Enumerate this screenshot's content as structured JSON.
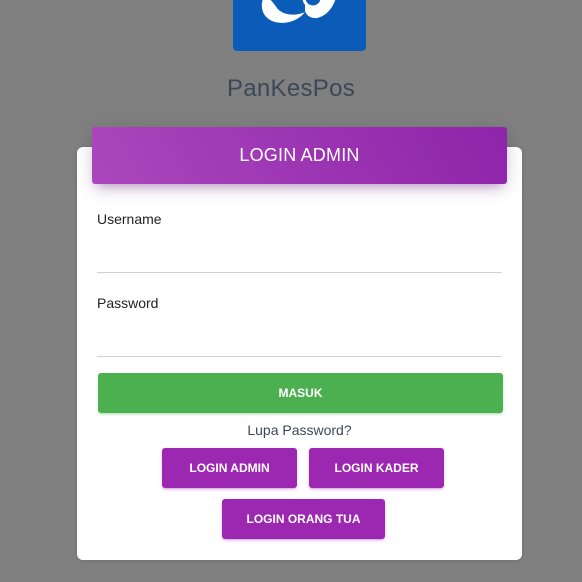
{
  "logo": {
    "icon": "posyandu-logo-icon",
    "color": "#0b5cb8"
  },
  "app": {
    "title": "PanKesPos"
  },
  "card": {
    "header": "LOGIN ADMIN",
    "header_color": "#9c27b0"
  },
  "form": {
    "username_label": "Username",
    "username_value": "",
    "password_label": "Password",
    "password_value": "",
    "submit_label": "MASUK",
    "submit_color": "#4caf50",
    "forgot_label": "Lupa Password?"
  },
  "roles": {
    "admin_label": "LOGIN ADMIN",
    "kader_label": "LOGIN KADER",
    "parent_label": "LOGIN ORANG TUA",
    "button_color": "#9c27b0"
  }
}
